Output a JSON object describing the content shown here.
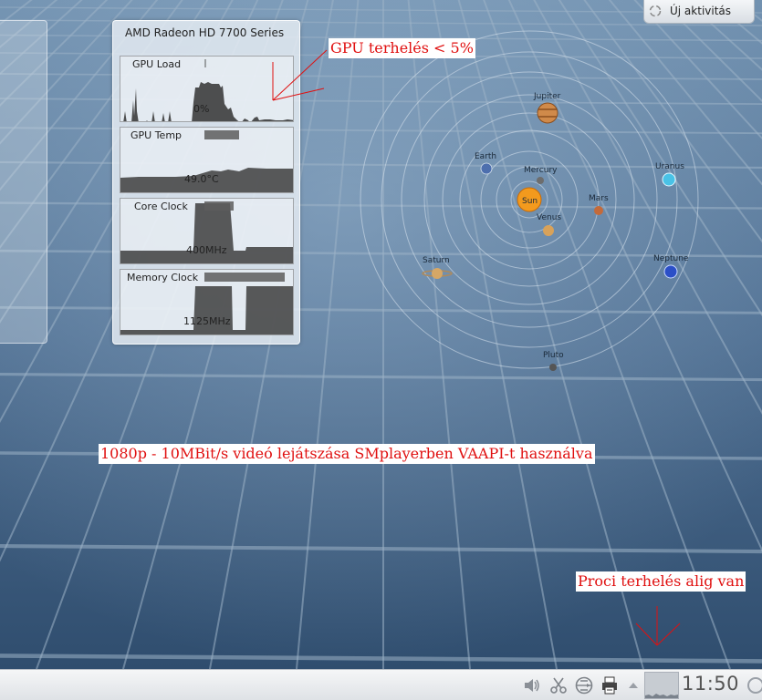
{
  "gpu_widget": {
    "title": "AMD Radeon HD 7700 Series",
    "graphs": [
      {
        "label": "GPU Load",
        "value": "0%"
      },
      {
        "label": "GPU Temp",
        "value": "49.0°C"
      },
      {
        "label": "Core Clock",
        "value": "400MHz"
      },
      {
        "label": "Memory Clock",
        "value": "1125MHz"
      }
    ]
  },
  "annotations": {
    "gpu_load": "GPU terhelés < 5%",
    "video_info": "1080p - 10MBit/s videó lejátszása SMplayerben VAAPI-t használva",
    "cpu_load": "Proci terhelés alig van"
  },
  "solar_system": {
    "sun": "Sun",
    "planets": [
      "Mercury",
      "Venus",
      "Earth",
      "Mars",
      "Jupiter",
      "Saturn",
      "Uranus",
      "Neptune",
      "Pluto"
    ]
  },
  "activity_button": {
    "label": "Új aktivitás"
  },
  "taskbar": {
    "clock": "11:50",
    "tray_icons": [
      "volume-icon",
      "tools-icon",
      "network-icon",
      "printer-icon",
      "expand-icon"
    ]
  },
  "colors": {
    "annotation_text": "#e01010",
    "sun": "#f39a1d",
    "wallpaper": "#4d6f8f"
  }
}
